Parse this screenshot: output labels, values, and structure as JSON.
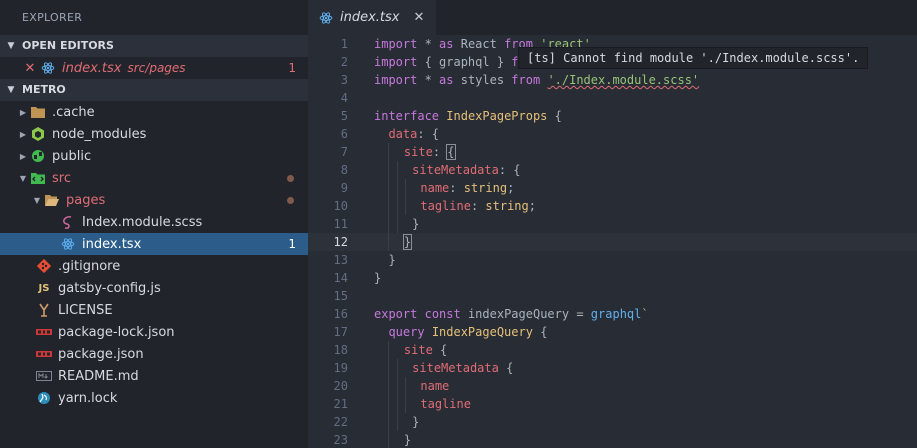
{
  "explorer": {
    "title": "EXPLORER",
    "open_editors": {
      "header": "OPEN EDITORS",
      "items": [
        {
          "name": "index.tsx",
          "path": "src/pages",
          "badge": "1"
        }
      ]
    },
    "project": {
      "header": "METRO",
      "items": [
        {
          "name": ".cache",
          "kind": "folder"
        },
        {
          "name": "node_modules",
          "kind": "folder"
        },
        {
          "name": "public",
          "kind": "folder"
        },
        {
          "name": "src",
          "kind": "folder-open"
        },
        {
          "name": "pages",
          "kind": "folder-open"
        },
        {
          "name": "Index.module.scss",
          "kind": "scss"
        },
        {
          "name": "index.tsx",
          "kind": "react",
          "badge": "1"
        },
        {
          "name": ".gitignore",
          "kind": "git"
        },
        {
          "name": "gatsby-config.js",
          "kind": "js"
        },
        {
          "name": "LICENSE",
          "kind": "license"
        },
        {
          "name": "package-lock.json",
          "kind": "npm"
        },
        {
          "name": "package.json",
          "kind": "npm"
        },
        {
          "name": "README.md",
          "kind": "md"
        },
        {
          "name": "yarn.lock",
          "kind": "yarn"
        }
      ]
    }
  },
  "editor": {
    "tab": {
      "name": "index.tsx"
    },
    "tooltip": "[ts] Cannot find module './Index.module.scss'.",
    "line_numbers": [
      "1",
      "2",
      "3",
      "4",
      "5",
      "6",
      "7",
      "8",
      "9",
      "10",
      "11",
      "12",
      "13",
      "14",
      "15",
      "16",
      "17",
      "18",
      "19",
      "20",
      "21",
      "22",
      "23"
    ],
    "code": {
      "l1": {
        "a": "import",
        "b": " * ",
        "c": "as",
        "d": " React ",
        "e": "from",
        "f": "'react'"
      },
      "l2": {
        "a": "import",
        "b": " { graphql } ",
        "c": "from"
      },
      "l3": {
        "a": "import",
        "b": " * ",
        "c": "as",
        "d": " styles ",
        "e": "from",
        "f": "'./Index.module.scss'"
      },
      "l5": {
        "a": "interface",
        "b": "IndexPageProps",
        "c": " {"
      },
      "l6": {
        "a": "data",
        "b": ": {"
      },
      "l7": {
        "a": "site",
        "b": ": ",
        "c": "{"
      },
      "l8": {
        "a": "siteMetadata",
        "b": ": {"
      },
      "l9": {
        "a": "name",
        "b": ": ",
        "c": "string",
        "d": ";"
      },
      "l10": {
        "a": "tagline",
        "b": ": ",
        "c": "string",
        "d": ";"
      },
      "l11": {
        "a": "}"
      },
      "l12": {
        "a": "}"
      },
      "l13": {
        "a": "}"
      },
      "l14": {
        "a": "}"
      },
      "l16": {
        "a": "export",
        "b": "const",
        "c": "indexPageQuery",
        "d": " = ",
        "e": "graphql",
        "f": "`"
      },
      "l17": {
        "a": "query",
        "b": "IndexPageQuery",
        "c": " {"
      },
      "l18": {
        "a": "site",
        "b": " {"
      },
      "l19": {
        "a": "siteMetadata",
        "b": " {"
      },
      "l20": {
        "a": "name"
      },
      "l21": {
        "a": "tagline"
      },
      "l22": {
        "a": "}"
      },
      "l23": {
        "a": "}"
      }
    }
  }
}
